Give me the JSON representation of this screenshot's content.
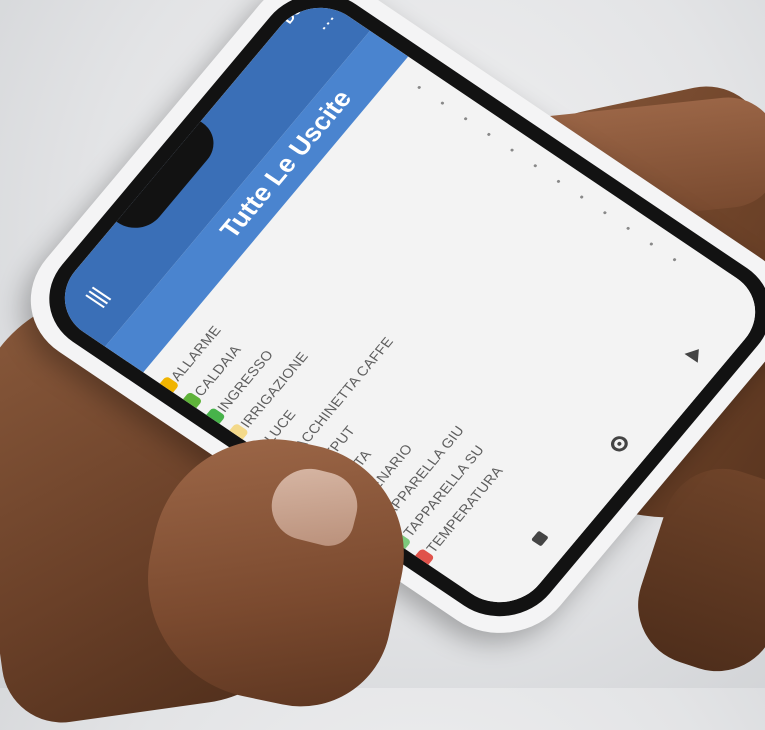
{
  "app": {
    "title": "Domotica APP",
    "page_title": "Tutte Le Uscite",
    "more_icon": "more-vert-icon",
    "menu_icon": "hamburger-menu-icon"
  },
  "list": {
    "items": [
      {
        "label": "ALLARME",
        "icon": "lock-icon",
        "color": "#f0b400"
      },
      {
        "label": "CALDAIA",
        "icon": "boiler-icon",
        "color": "#5fb33a"
      },
      {
        "label": "INGRESSO",
        "icon": "power-icon",
        "color": "#47b34a"
      },
      {
        "label": "IRRIGAZIONE",
        "icon": "sprinkler-icon",
        "color": "#f3d98a"
      },
      {
        "label": "LUCE",
        "icon": "light-icon",
        "color": "#3f8fe0"
      },
      {
        "label": "MACCHINETTA CAFFE",
        "icon": "coffee-icon",
        "color": "#6aa93a"
      },
      {
        "label": "OUTPUT",
        "icon": "power-icon",
        "color": "#2f9e3d"
      },
      {
        "label": "PORTA",
        "icon": "door-icon",
        "color": "#222222"
      },
      {
        "label": "SCENARIO",
        "icon": "scenario-icon",
        "color": "#e08a1f"
      },
      {
        "label": "TAPPARELLA GIU",
        "icon": "blind-down-icon",
        "color": "#7cc97c"
      },
      {
        "label": "TAPPARELLA SU",
        "icon": "blind-up-icon",
        "color": "#7cc97c"
      },
      {
        "label": "TEMPERATURA",
        "icon": "thermometer-icon",
        "color": "#e0524a"
      }
    ]
  },
  "navbar": {
    "back_icon": "back-triangle-icon",
    "home_icon": "home-circle-icon",
    "recent_icon": "recent-square-icon"
  },
  "colors": {
    "appbar": "#3a6fb7",
    "header_band": "#4a84cf"
  }
}
